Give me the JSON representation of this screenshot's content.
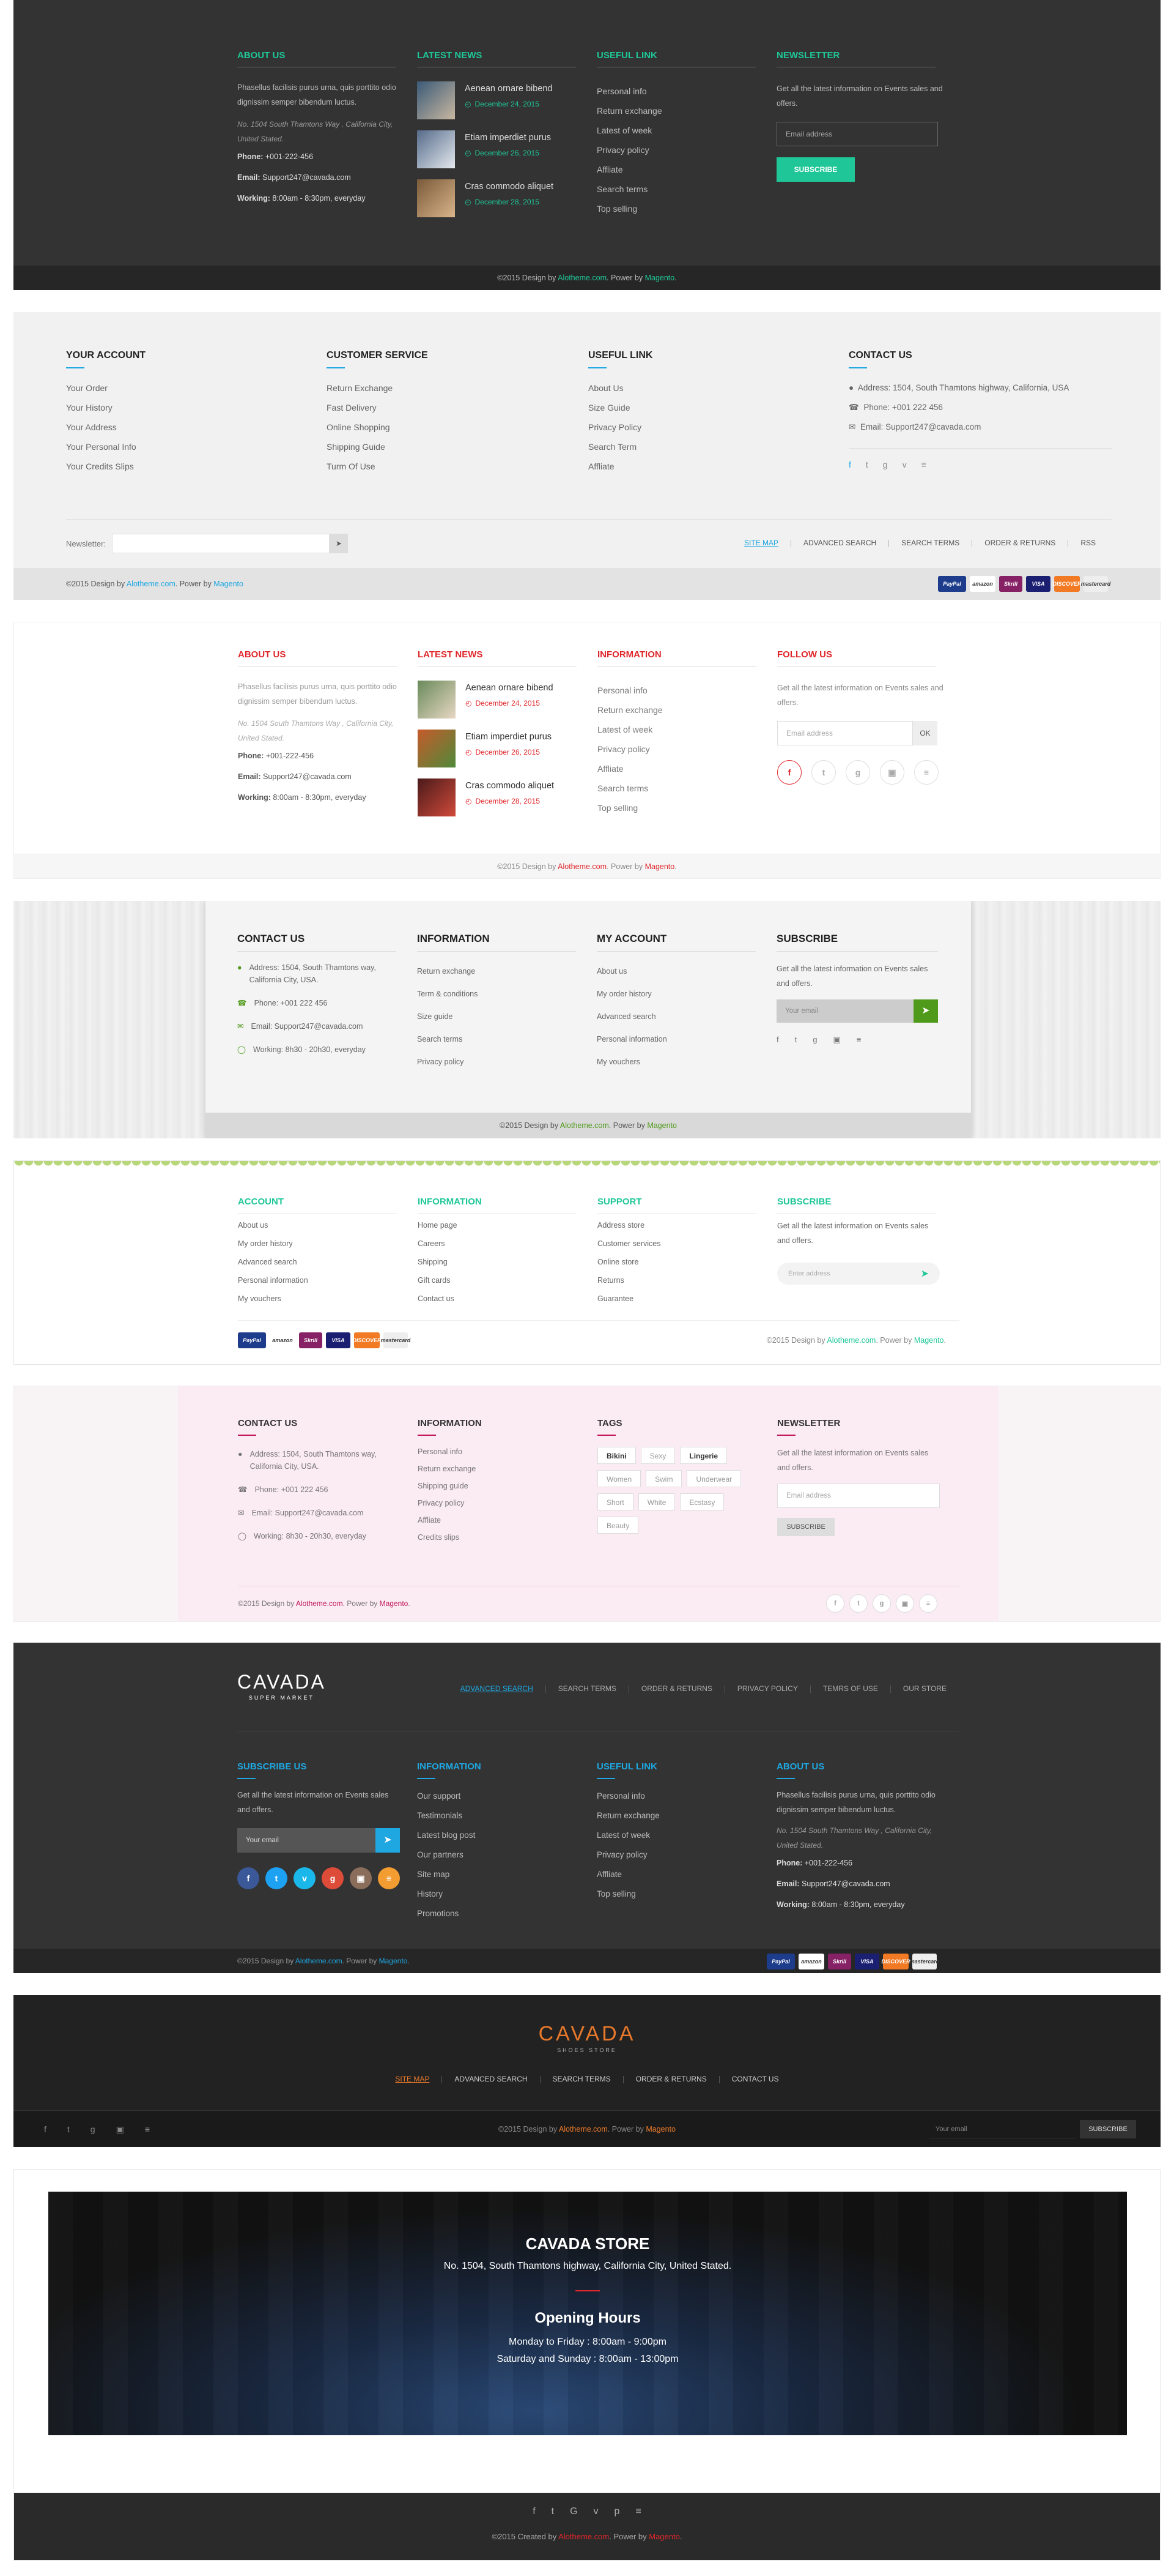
{
  "f1": {
    "about_title": "ABOUT US",
    "about_text": "Phasellus facilisis purus urna, quis porttito odio dignissim semper bibendum luctus.",
    "address": "No. 1504 South Thamtons Way , California City, United Stated.",
    "phone_label": "Phone:",
    "phone": "+001-222-456",
    "email_label": "Email:",
    "email": "Support247@cavada.com",
    "working_label": "Working:",
    "working": "8:00am - 8:30pm, everyday",
    "news_title": "LATEST NEWS",
    "news": [
      {
        "title": "Aenean ornare bibend",
        "date": "December 24, 2015"
      },
      {
        "title": "Etiam imperdiet purus",
        "date": "December 26, 2015"
      },
      {
        "title": "Cras commodo aliquet",
        "date": "December 28, 2015"
      }
    ],
    "links_title": "USEFUL LINK",
    "links": [
      "Personal info",
      "Return exchange",
      "Latest of week",
      "Privacy policy",
      "Affliate",
      "Search terms",
      "Top selling"
    ],
    "newsletter_title": "NEWSLETTER",
    "newsletter_text": "Get all the latest information on Events sales and offers.",
    "email_placeholder": "Email address",
    "subscribe": "SUBSCRIBE",
    "copy_a": "©2015 Design by ",
    "copy_brand": "Alotheme.com",
    "copy_b": ". Power by ",
    "copy_power": "Magento",
    "copy_c": ".",
    "accent": "#1fc798"
  },
  "f2": {
    "col1_title": "YOUR ACCOUNT",
    "col1": [
      "Your Order",
      "Your History",
      "Your Address",
      "Your Personal Info",
      "Your Credits Slips"
    ],
    "col2_title": "CUSTOMER SERVICE",
    "col2": [
      "Return Exchange",
      "Fast Delivery",
      "Online Shopping",
      "Shipping Guide",
      "Turm Of Use"
    ],
    "col3_title": "USEFUL LINK",
    "col3": [
      "About Us",
      "Size Guide",
      "Privacy Policy",
      "Search Term",
      "Affliate"
    ],
    "contact_title": "CONTACT US",
    "address": "Address: 1504, South Thamtons highway, California, USA",
    "phone": "Phone: +001 222 456",
    "email": "Email: Support247@cavada.com",
    "newsletter_label": "Newsletter:",
    "nav": [
      "SITE MAP",
      "ADVANCED SEARCH",
      "SEARCH TERMS",
      "ORDER & RETURNS",
      "RSS"
    ],
    "copy_a": "©2015 Design by ",
    "copy_brand": "Alotheme.com",
    "copy_b": ". Power by ",
    "copy_power": "Magento",
    "payments": [
      "PayPal",
      "amazon",
      "Skrill",
      "VISA",
      "DISCOVER",
      "mastercard"
    ],
    "accent": "#1ea7e1"
  },
  "f3": {
    "about_title": "ABOUT US",
    "about_text": "Phasellus facilisis purus urna, quis porttito odio dignissim semper bibendum luctus.",
    "address": "No. 1504 South Thamtons Way , California City, United Stated.",
    "phone_label": "Phone:",
    "phone": "+001-222-456",
    "email_label": "Email:",
    "email": "Support247@cavada.com",
    "working_label": "Working:",
    "working": "8:00am - 8:30pm, everyday",
    "news_title": "LATEST NEWS",
    "news": [
      {
        "title": "Aenean ornare bibend",
        "date": "December 24, 2015"
      },
      {
        "title": "Etiam imperdiet purus",
        "date": "December 26, 2015"
      },
      {
        "title": "Cras commodo aliquet",
        "date": "December 28, 2015"
      }
    ],
    "info_title": "INFORMATION",
    "links": [
      "Personal info",
      "Return exchange",
      "Latest of week",
      "Privacy policy",
      "Affliate",
      "Search terms",
      "Top selling"
    ],
    "follow_title": "FOLLOW US",
    "follow_text": "Get all the latest information on Events sales and offers.",
    "email_placeholder": "Email address",
    "ok": "OK",
    "copy_a": "©2015 Design by ",
    "copy_brand": "Alotheme.com",
    "copy_b": ". Power by ",
    "copy_power": "Magento",
    "copy_c": ".",
    "accent": "#e0262b"
  },
  "f4": {
    "contact_title": "CONTACT US",
    "address": "Address: 1504, South Thamtons way, California City, USA.",
    "phone": "Phone: +001 222 456",
    "email": "Email: Support247@cavada.com",
    "working": "Working: 8h30 - 20h30, everyday",
    "info_title": "INFORMATION",
    "info": [
      "Return exchange",
      "Term & conditions",
      "Size guide",
      "Search terms",
      "Privacy policy"
    ],
    "account_title": "MY ACCOUNT",
    "account": [
      "About us",
      "My order history",
      "Advanced search",
      "Personal information",
      "My vouchers"
    ],
    "subscribe_title": "SUBSCRIBE",
    "subscribe_text": "Get all the latest information on Events sales and offers.",
    "email_placeholder": "Your email",
    "copy_a": "©2015 Design by ",
    "copy_brand": "Alotheme.com",
    "copy_b": ". Power by ",
    "copy_power": "Magento",
    "accent": "#4f9a1b"
  },
  "f5": {
    "account_title": "ACCOUNT",
    "account": [
      "About us",
      "My order history",
      "Advanced search",
      "Personal information",
      "My vouchers"
    ],
    "info_title": "INFORMATION",
    "info": [
      "Home page",
      "Careers",
      "Shipping",
      "Gift cards",
      "Contact us"
    ],
    "support_title": "SUPPORT",
    "support": [
      "Address store",
      "Customer services",
      "Online store",
      "Returns",
      "Guarantee"
    ],
    "subscribe_title": "SUBSCRIBE",
    "subscribe_text": "Get all the latest information on Events sales and offers.",
    "email_placeholder": "Enter address",
    "copy_a": "©2015 Design by ",
    "copy_brand": "Alotheme.com",
    "copy_b": ". Power by ",
    "copy_power": "Magento",
    "copy_c": ".",
    "payments": [
      "PayPal",
      "amazon",
      "Skrill",
      "VISA",
      "DISCOVER",
      "mastercard"
    ],
    "accent": "#1fc798"
  },
  "f6": {
    "contact_title": "CONTACT US",
    "address": "Address: 1504, South Thamtons way, California City, USA.",
    "phone": "Phone: +001 222 456",
    "email": "Email: Support247@cavada.com",
    "working": "Working: 8h30 - 20h30, everyday",
    "info_title": "INFORMATION",
    "info": [
      "Personal info",
      "Return exchange",
      "Shipping guide",
      "Privacy policy",
      "Affliate",
      "Credits slips"
    ],
    "tags_title": "TAGS",
    "tags": [
      [
        "Bikini",
        "Sexy",
        "Lingerie"
      ],
      [
        "Women",
        "Swim",
        "Underwear"
      ],
      [
        "Short",
        "White",
        "Ecstasy"
      ],
      [
        "Beauty"
      ]
    ],
    "newsletter_title": "NEWSLETTER",
    "newsletter_text": "Get all the latest information on Events sales and offers.",
    "email_placeholder": "Email address",
    "subscribe": "SUBSCRIBE",
    "copy_a": "©2015 Design by ",
    "copy_brand": "Alotheme.com",
    "copy_b": ". Power by ",
    "copy_power": "Magento",
    "copy_c": ".",
    "accent": "#c2185b"
  },
  "f7": {
    "logo": "CAVADA",
    "logo_sub": "SUPER MARKET",
    "nav": [
      "ADVANCED SEARCH",
      "SEARCH TERMS",
      "ORDER & RETURNS",
      "PRIVACY POLICY",
      "TEMRS OF USE",
      "OUR STORE"
    ],
    "subscribe_title": "SUBSCRIBE US",
    "subscribe_text": "Get all the latest information on Events sales and offers.",
    "email_placeholder": "Your email",
    "info_title": "INFORMATION",
    "info": [
      "Our support",
      "Testimonials",
      "Latest blog post",
      "Our partners",
      "Site map",
      "History",
      "Promotions"
    ],
    "links_title": "USEFUL LINK",
    "links": [
      "Personal info",
      "Return exchange",
      "Latest of week",
      "Privacy policy",
      "Affliate",
      "Top selling"
    ],
    "about_title": "ABOUT US",
    "about_text": "Phasellus facilisis purus urna, quis porttito odio dignissim semper bibendum luctus.",
    "address": "No. 1504 South Thamtons Way , California City, United Stated.",
    "phone_label": "Phone:",
    "phone": "+001-222-456",
    "email_label": "Email:",
    "email": "Support247@cavada.com",
    "working_label": "Working:",
    "working": "8:00am - 8:30pm, everyday",
    "copy_a": "©2015 Design by ",
    "copy_brand": "Alotheme.com",
    "copy_b": ". Power by ",
    "copy_power": "Magento",
    "copy_c": ".",
    "payments": [
      "PayPal",
      "amazon",
      "Skrill",
      "VISA",
      "DISCOVER",
      "mastercard"
    ],
    "accent": "#1ea7e1"
  },
  "f8": {
    "logo": "CAVADA",
    "logo_sub": "SHOES STORE",
    "nav": [
      "SITE MAP",
      "ADVANCED SEARCH",
      "SEARCH TERMS",
      "ORDER & RETURNS",
      "CONTACT US"
    ],
    "copy_a": "©2015 Design by ",
    "copy_brand": "Alotheme.com",
    "copy_b": ". Power by ",
    "copy_power": "Magento",
    "email_placeholder": "Your email",
    "subscribe": "SUBSCRIBE",
    "accent": "#e8792b"
  },
  "f9": {
    "store_title": "CAVADA STORE",
    "address": "No. 1504, South Thamtons highway, California City, United Stated.",
    "hours_title": "Opening Hours",
    "weekdays": "Monday to Friday : 8:00am - 9:00pm",
    "weekend": "Saturday and Sunday : 8:00am - 13:00pm",
    "copy_a": "©2015 Created by ",
    "copy_brand": "Alotheme.com",
    "copy_b": ". Power by ",
    "copy_power": "Magento",
    "copy_c": ".",
    "accent": "#e0262b"
  }
}
